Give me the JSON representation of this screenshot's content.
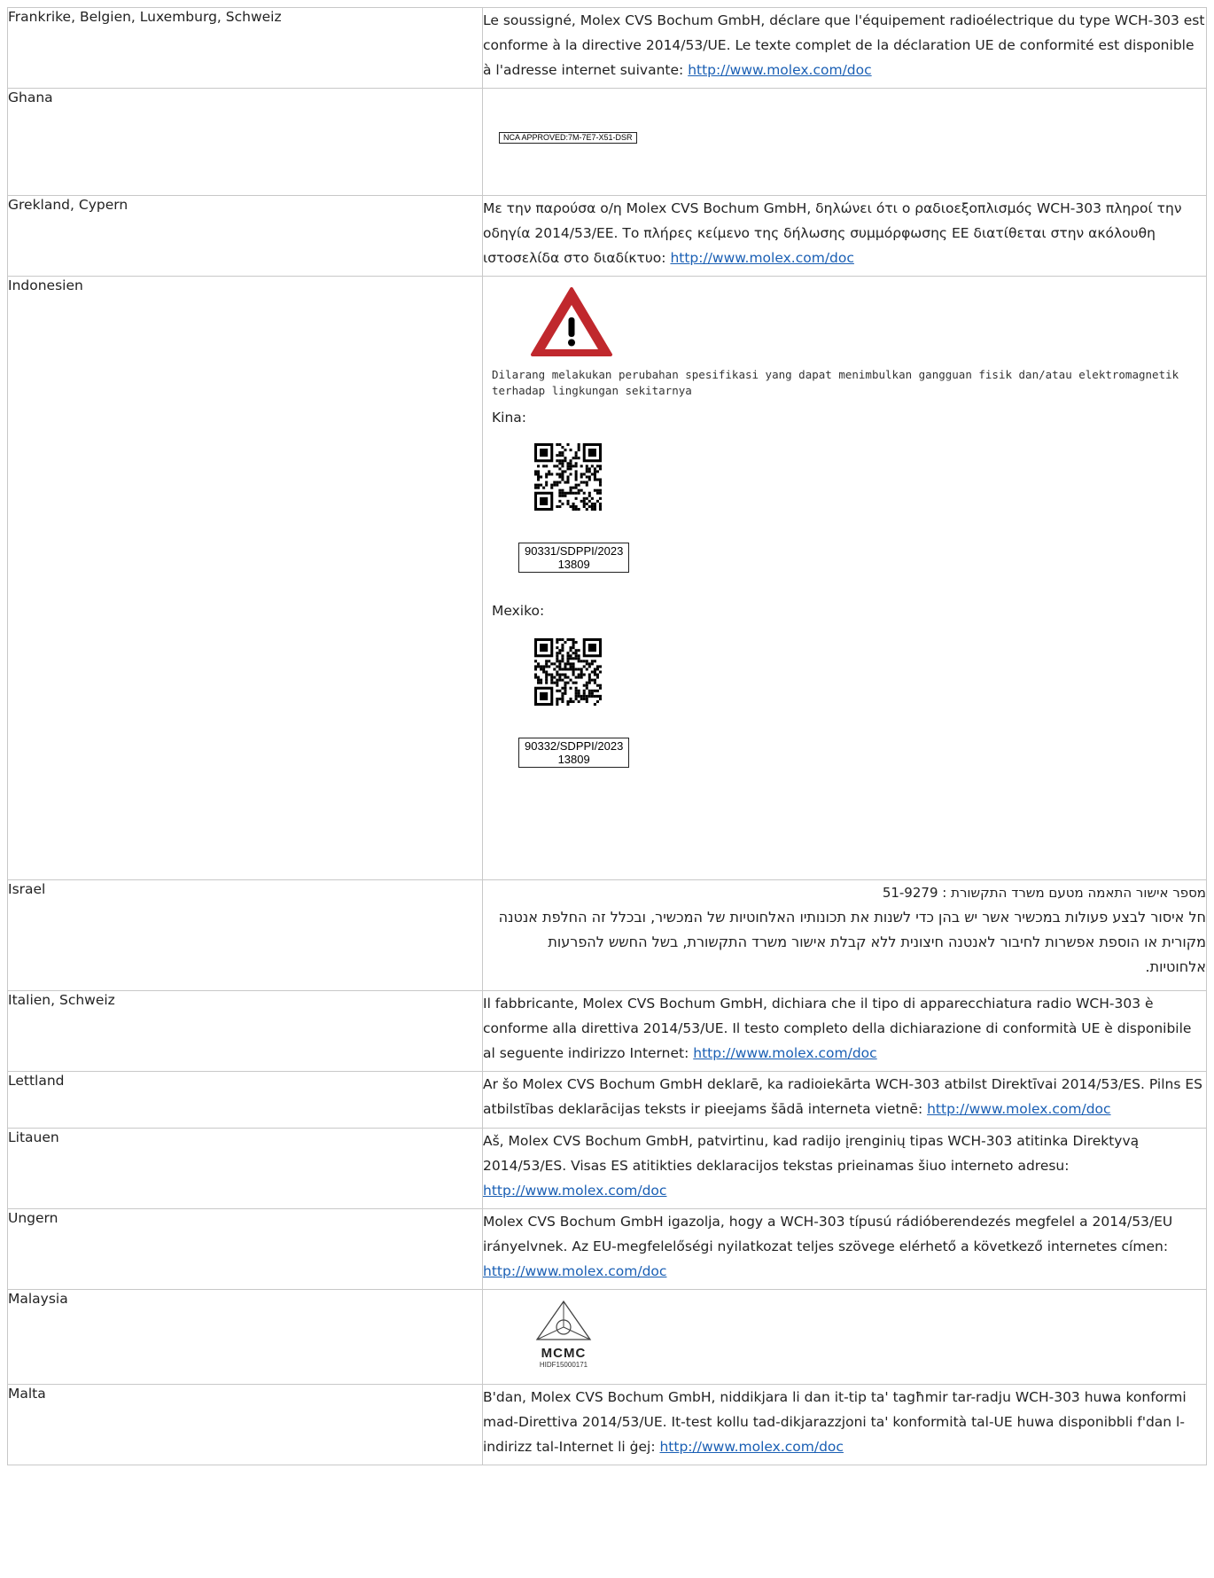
{
  "rows": [
    {
      "country": "Frankrike, Belgien, Luxemburg, Schweiz",
      "text": "Le soussigné, Molex CVS Bochum GmbH, déclare que l'équipement radioélectrique du type WCH-303 est conforme à la directive 2014/53/UE. Le texte complet de la déclaration UE de conformité est disponible à l'adresse internet suivante: ",
      "link": "http://www.molex.com/doc"
    },
    {
      "country": "Ghana",
      "label_code": "NCA APPROVED:7M-7E7-X51-DSR"
    },
    {
      "country": "Grekland, Cypern",
      "text": "Με την παρούσα ο/η Molex CVS Bochum GmbH, δηλώνει ότι ο ραδιοεξοπλισμός WCH-303 πληροί την οδηγία 2014/53/ΕΕ. Το πλήρες κείμενο της δήλωσης συμμόρφωσης ΕΕ διατίθεται στην ακόλουθη ιστοσελίδα στο διαδίκτυο: ",
      "link": "http://www.molex.com/doc"
    },
    {
      "country": "Indonesien",
      "warning": "Dilarang melakukan perubahan spesifikasi yang dapat menimbulkan gangguan fisik dan/atau elektromagnetik terhadap lingkungan sekitarnya",
      "china_label": "Kina:",
      "china_code_line1": "90331/SDPPI/2023",
      "china_code_line2": "13809",
      "mexico_label": "Mexiko:",
      "mexico_code_line1": "90332/SDPPI/2023",
      "mexico_code_line2": "13809"
    },
    {
      "country": "Israel",
      "line1": "מספר אישור התאמה מטעם משרד התקשורת : 51-9279",
      "line2": "חל איסור לבצע פעולות במכשיר אשר יש בהן כדי לשנות את תכונותיו האלחוטיות של המכשיר, ובכלל זה החלפת אנטנה מקורית או הוספת אפשרות לחיבור לאנטנה חיצונית ללא קבלת אישור משרד התקשורת, בשל החשש להפרעות אלחוטיות."
    },
    {
      "country": "Italien, Schweiz",
      "text": "Il fabbricante, Molex CVS Bochum GmbH, dichiara che il tipo di apparecchiatura radio WCH-303 è conforme alla direttiva 2014/53/UE. Il testo completo della dichiarazione di conformità UE è disponibile al seguente indirizzo Internet: ",
      "link": "http://www.molex.com/doc"
    },
    {
      "country": "Lettland",
      "text": "Ar šo Molex CVS Bochum GmbH deklarē, ka radioiekārta WCH-303 atbilst Direktīvai 2014/53/ES. Pilns ES atbilstības deklarācijas teksts ir pieejams šādā interneta vietnē: ",
      "link": "http://www.molex.com/doc"
    },
    {
      "country": "Litauen",
      "text": "Aš, Molex CVS Bochum GmbH, patvirtinu, kad radijo įrenginių tipas WCH-303 atitinka Direktyvą 2014/53/ES. Visas ES atitikties deklaracijos tekstas prieinamas šiuo interneto adresu: ",
      "link": "http://www.molex.com/doc"
    },
    {
      "country": "Ungern",
      "text": "Molex CVS Bochum GmbH igazolja, hogy a WCH-303 típusú rádióberendezés megfelel a 2014/53/EU irányelvnek. Az EU-megfelelőségi nyilatkozat teljes szövege elérhető a következő internetes címen: ",
      "link": "http://www.molex.com/doc"
    },
    {
      "country": "Malaysia",
      "logo_text": "MCMC",
      "logo_code": "HIDF15000171"
    },
    {
      "country": "Malta",
      "text": "B'dan, Molex CVS Bochum GmbH, niddikjara li dan it-tip ta' tagħmir tar-radju WCH-303 huwa konformi mad-Direttiva 2014/53/UE. It-test kollu tad-dikjarazzjoni ta' konformità tal-UE huwa disponibbli f'dan l-indirizz tal-Internet li ġej: ",
      "link": "http://www.molex.com/doc"
    }
  ],
  "colors": {
    "link": "#1a5fb4",
    "warning_red": "#c0282d",
    "border": "#c8c8c8"
  },
  "icons": [
    "warning-triangle-icon",
    "qr-code-icon",
    "mcmc-logo-icon"
  ]
}
